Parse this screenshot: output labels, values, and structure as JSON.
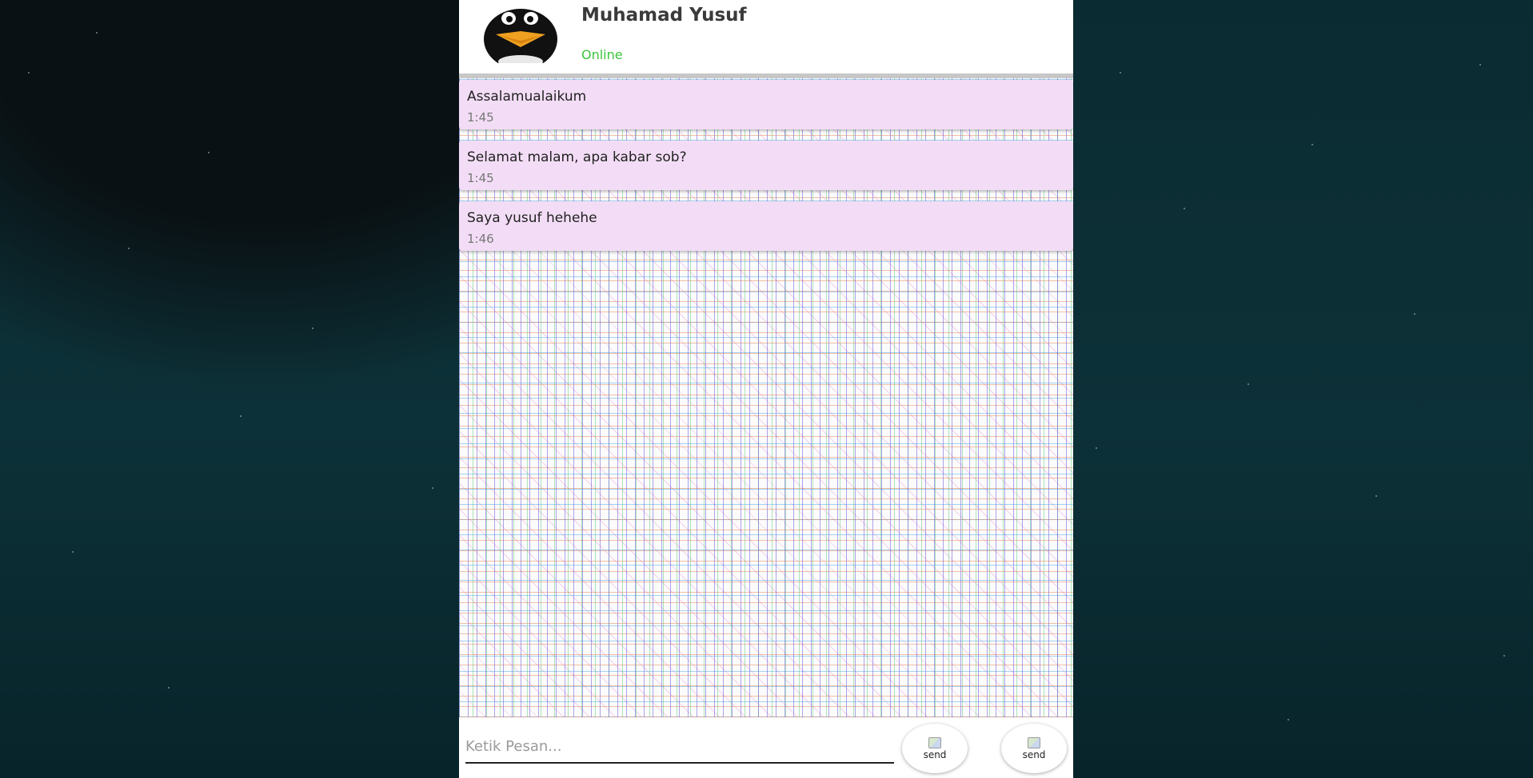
{
  "contact": {
    "name": "Muhamad Yusuf",
    "status": "Online"
  },
  "messages": [
    {
      "text": "Assalamualaikum",
      "time": "1:45"
    },
    {
      "text": "Selamat malam, apa kabar sob?",
      "time": "1:45"
    },
    {
      "text": "Saya yusuf hehehe",
      "time": "1:46"
    }
  ],
  "composer": {
    "placeholder": "Ketik Pesan...",
    "send_label_1": "send",
    "send_label_2": "send"
  },
  "colors": {
    "status_online": "#3cc43c",
    "bubble": "#f3ddf6",
    "page_background": "#0b2a30"
  },
  "icons": {
    "avatar": "penguin-avatar-icon",
    "send": "broken-image-icon"
  }
}
